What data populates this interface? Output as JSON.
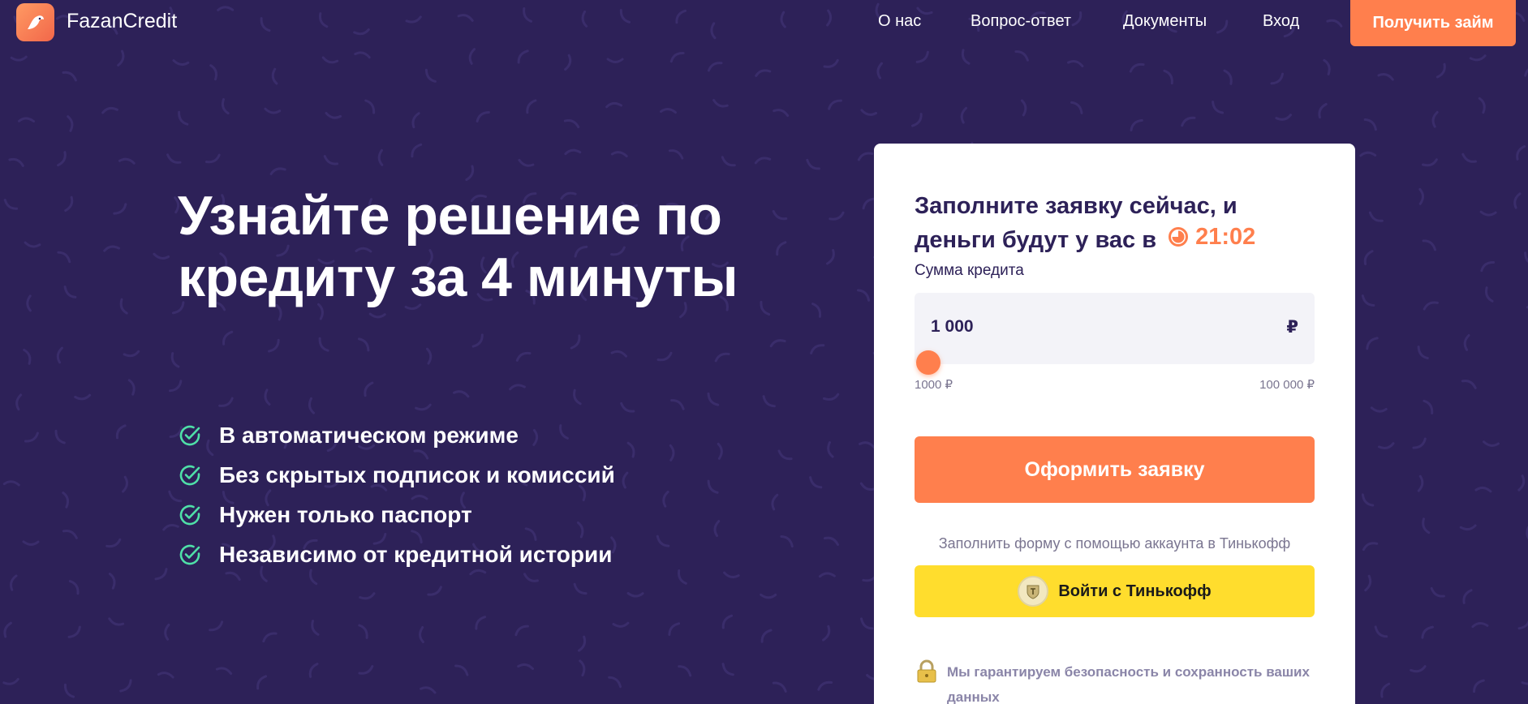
{
  "header": {
    "brand": "FazanCredit",
    "nav": [
      "О нас",
      "Вопрос-ответ",
      "Документы",
      "Вход"
    ],
    "cta": "Получить займ"
  },
  "hero": {
    "title": "Узнайте решение по кредиту за 4 минуты",
    "features": [
      "В автоматическом режиме",
      "Без скрытых подписок и комиссий",
      "Нужен только паспорт",
      "Независимо от кредитной истории"
    ]
  },
  "form": {
    "title": "Заполните заявку сейчас, и деньги будут у вас в",
    "timer": "21:02",
    "amount_label": "Сумма кредита",
    "amount_value": "1 000",
    "currency": "₽",
    "range_min": "1000 ₽",
    "range_max": "100 000 ₽",
    "slider_fraction": 0,
    "submit": "Оформить заявку",
    "tinkoff_hint": "Заполнить форму с помощью аккаунта в Тинькофф",
    "tinkoff_button": "Войти с Тинькофф",
    "security_note": "Мы гарантируем безопасность и сохранность ваших данных"
  },
  "colors": {
    "background": "#2d2158",
    "accent": "#ff7f4d",
    "check": "#4fe0a8",
    "tinkoff": "#ffdd2d"
  }
}
